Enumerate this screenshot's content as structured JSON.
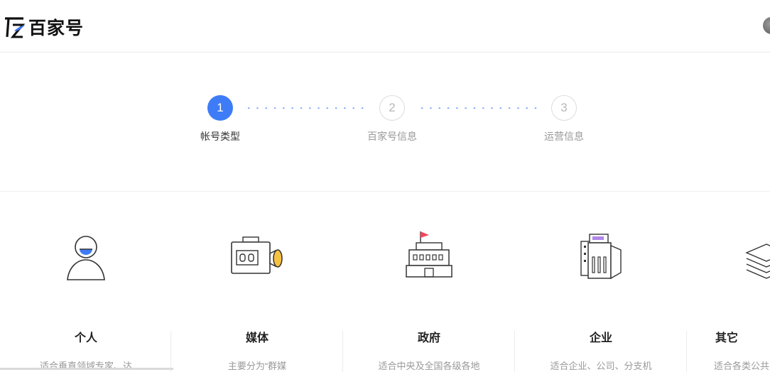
{
  "header": {
    "logo_text": "百家号"
  },
  "steps": [
    {
      "number": "1",
      "label": "帐号类型",
      "state": "active"
    },
    {
      "number": "2",
      "label": "百家号信息",
      "state": "inactive"
    },
    {
      "number": "3",
      "label": "运营信息",
      "state": "inactive"
    }
  ],
  "account_types": [
    {
      "title": "个人",
      "description": "适合垂直领域专家、达",
      "icon": "person-icon"
    },
    {
      "title": "媒体",
      "description": "主要分为“群媒",
      "icon": "video-camera-icon"
    },
    {
      "title": "政府",
      "description": "适合中央及全国各级各地",
      "icon": "government-building-icon"
    },
    {
      "title": "企业",
      "description": "适合企业、公司、分支机",
      "icon": "office-building-icon"
    },
    {
      "title": "其它",
      "description": "适合各类公共",
      "icon": "stack-icon"
    }
  ],
  "colors": {
    "accent": "#3e7cf7",
    "highlight_yellow": "#f6c243",
    "flag_red": "#f0465a"
  }
}
